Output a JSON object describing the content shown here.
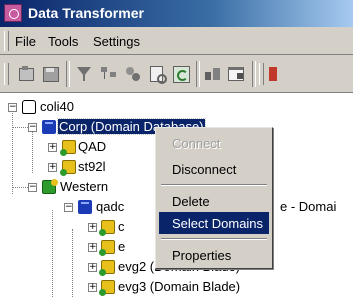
{
  "window": {
    "title": "Data Transformer"
  },
  "menu": {
    "items": [
      "File",
      "Tools",
      "Settings"
    ]
  },
  "toolbar": {
    "buttons": [
      "open-icon",
      "save-icon",
      "filter-icon",
      "tree-icon",
      "transform-icon",
      "preview-icon",
      "refresh-icon",
      "import-icon",
      "properties-icon",
      "run-icon"
    ]
  },
  "tree": {
    "root": "coli40",
    "corp": "Corp (Domain Database)",
    "qad": "QAD",
    "st92": "st92l",
    "western": "Western",
    "qadc": "qadc",
    "qadc_suffix": "e - Domai",
    "child_c": "c",
    "child_e": "e",
    "evg2": "evg2 (Domain Blade)",
    "evg3": "evg3 (Domain Blade)"
  },
  "context_menu": {
    "connect": "Connect",
    "disconnect": "Disconnect",
    "delete": "Delete",
    "select_domains": "Select Domains",
    "properties": "Properties"
  },
  "colors": {
    "title_bar": "#0a246a",
    "selection": "#0a246a",
    "chrome": "#d4d0c8"
  }
}
